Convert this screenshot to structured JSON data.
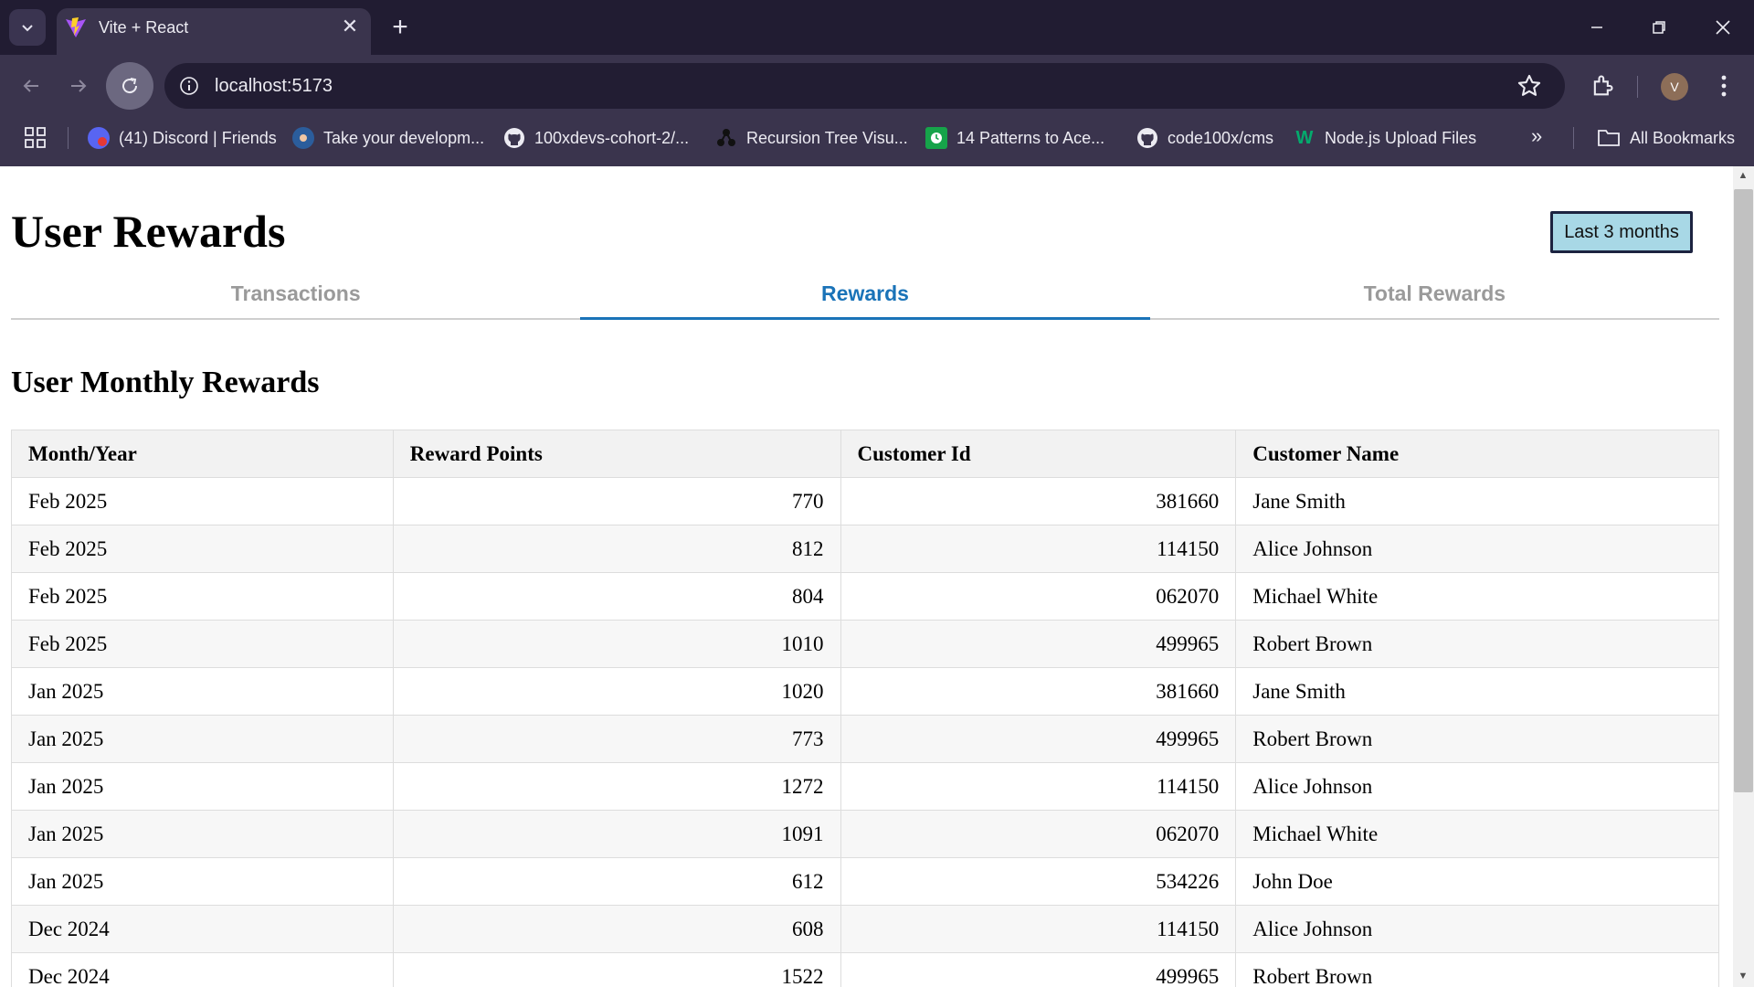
{
  "browser": {
    "tab_title": "Vite + React",
    "url": "localhost:5173",
    "avatar_letter": "V",
    "bookmarks": [
      {
        "label": "(41) Discord | Friends",
        "icon": "discord-icon"
      },
      {
        "label": "Take your developm...",
        "icon": "profile-icon"
      },
      {
        "label": "100xdevs-cohort-2/...",
        "icon": "github-icon"
      },
      {
        "label": "Recursion Tree Visu...",
        "icon": "tree-icon"
      },
      {
        "label": "14 Patterns to Ace...",
        "icon": "clock-icon"
      },
      {
        "label": "code100x/cms",
        "icon": "github-icon"
      },
      {
        "label": "Node.js Upload Files",
        "icon": "w3schools-icon"
      }
    ],
    "all_bookmarks_label": "All Bookmarks",
    "more_bookmarks_label": "»"
  },
  "page": {
    "title": "User Rewards",
    "range_button_label": "Last 3 months",
    "tabs": [
      {
        "label": "Transactions",
        "active": false
      },
      {
        "label": "Rewards",
        "active": true
      },
      {
        "label": "Total Rewards",
        "active": false
      }
    ],
    "section_title": "User Monthly Rewards"
  },
  "table": {
    "headers": [
      "Month/Year",
      "Reward Points",
      "Customer Id",
      "Customer Name"
    ],
    "rows": [
      {
        "month": "Feb 2025",
        "points": "770",
        "customer_id": "381660",
        "name": "Jane Smith"
      },
      {
        "month": "Feb 2025",
        "points": "812",
        "customer_id": "114150",
        "name": "Alice Johnson"
      },
      {
        "month": "Feb 2025",
        "points": "804",
        "customer_id": "062070",
        "name": "Michael White"
      },
      {
        "month": "Feb 2025",
        "points": "1010",
        "customer_id": "499965",
        "name": "Robert Brown"
      },
      {
        "month": "Jan 2025",
        "points": "1020",
        "customer_id": "381660",
        "name": "Jane Smith"
      },
      {
        "month": "Jan 2025",
        "points": "773",
        "customer_id": "499965",
        "name": "Robert Brown"
      },
      {
        "month": "Jan 2025",
        "points": "1272",
        "customer_id": "114150",
        "name": "Alice Johnson"
      },
      {
        "month": "Jan 2025",
        "points": "1091",
        "customer_id": "062070",
        "name": "Michael White"
      },
      {
        "month": "Jan 2025",
        "points": "612",
        "customer_id": "534226",
        "name": "John Doe"
      },
      {
        "month": "Dec 2024",
        "points": "608",
        "customer_id": "114150",
        "name": "Alice Johnson"
      },
      {
        "month": "Dec 2024",
        "points": "1522",
        "customer_id": "499965",
        "name": "Robert Brown"
      }
    ]
  },
  "colors": {
    "chrome_dark": "#211c32",
    "chrome": "#3a344d",
    "active_tab": "#1a73b8",
    "range_button": "#a8d8e6"
  }
}
